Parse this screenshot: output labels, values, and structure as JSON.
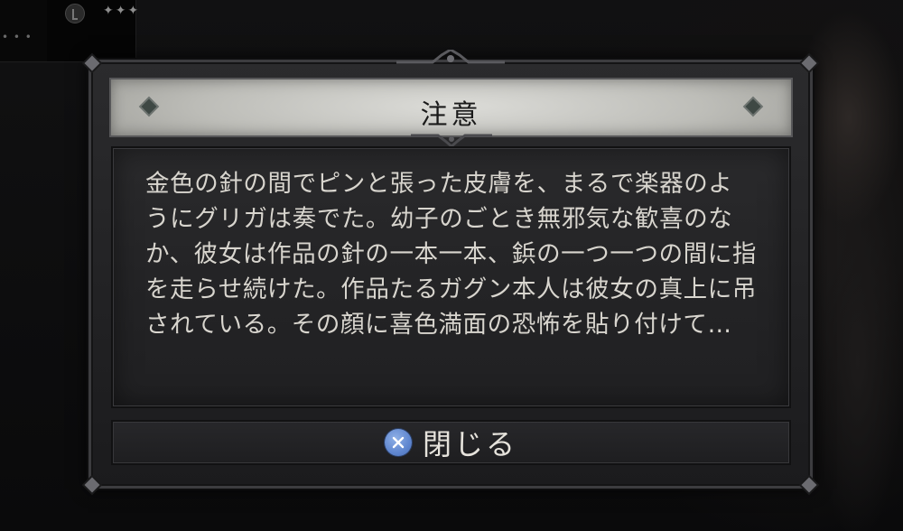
{
  "dialog": {
    "title": "注意",
    "body": "金色の針の間でピンと張った皮膚を、まるで楽器のようにグリガは奏でた。幼子のごとき無邪気な歓喜のなか、彼女は作品の針の一本一本、鋲の一つ一つの間に指を走らせ続けた。作品たるガグン本人は彼女の真上に吊されている。その顔に喜色満面の恐怖を貼り付けて…",
    "close_label": "閉じる",
    "close_icon": "cross-button-icon"
  },
  "hud": {
    "dots": "✦✦✦",
    "dots2": "• • •"
  },
  "colors": {
    "title_bg": "#c8c8c3",
    "panel_bg": "#252527",
    "text": "#d8d5ce",
    "button_icon": "#6b8fd6"
  }
}
